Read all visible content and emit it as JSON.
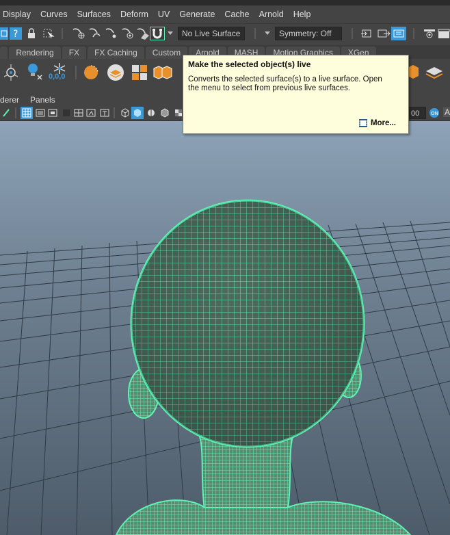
{
  "menu": [
    "Display",
    "Curves",
    "Surfaces",
    "Deform",
    "UV",
    "Generate",
    "Cache",
    "Arnold",
    "Help"
  ],
  "status_line": {
    "live_surface_label": "No Live Surface",
    "symmetry_label": "Symmetry: Off"
  },
  "shelf_tabs": [
    "Rendering",
    "FX",
    "FX Caching",
    "Custom",
    "Arnold",
    "MASH",
    "Motion Graphics",
    "XGen"
  ],
  "shelf": {
    "coords_label": "0,0,0"
  },
  "panel_menu": [
    "derer",
    "Panels"
  ],
  "view_bar": {
    "value_field": "00",
    "a_label": "A"
  },
  "tooltip": {
    "title": "Make the selected object(s) live",
    "description": "Converts the selected surface(s) to a live surface. Open the menu to select from previous live surfaces.",
    "more_label": "More..."
  },
  "colors": {
    "accent": "#3a9ad9",
    "wire": "#5ff2b4",
    "viewport_top": "#8ea3b8",
    "viewport_bottom": "#4e5c6a",
    "tooltip_bg": "#fefedc"
  }
}
